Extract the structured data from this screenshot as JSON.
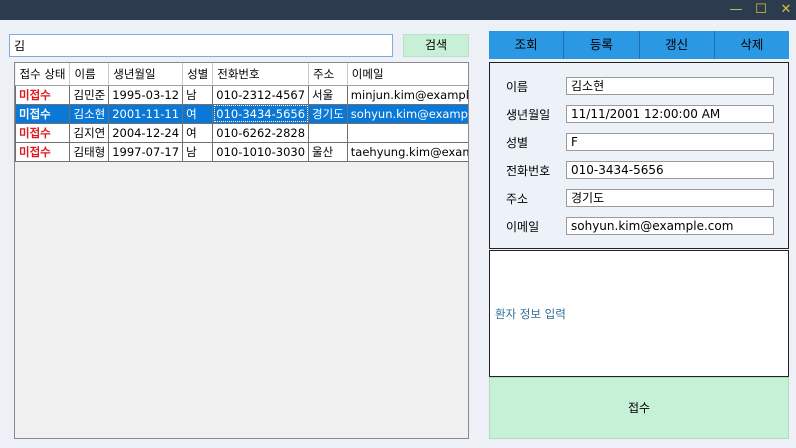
{
  "window": {
    "minimize_glyph": "—",
    "maximize_glyph": "☐",
    "close_glyph": "✕"
  },
  "search": {
    "value": "김",
    "button_label": "검색"
  },
  "patient_table": {
    "columns": [
      "접수 상태",
      "이름",
      "생년월일",
      "성별",
      "전화번호",
      "주소",
      "이메일"
    ],
    "rows": [
      {
        "status": "미접수",
        "name": "김민준",
        "birth": "1995-03-12",
        "gender": "남",
        "phone": "010-2312-4567",
        "address": "서울",
        "email": "minjun.kim@example.com"
      },
      {
        "status": "미접수",
        "name": "김소현",
        "birth": "2001-11-11",
        "gender": "여",
        "phone": "010-3434-5656",
        "address": "경기도",
        "email": "sohyun.kim@example.com"
      },
      {
        "status": "미접수",
        "name": "김지연",
        "birth": "2004-12-24",
        "gender": "여",
        "phone": "010-6262-2828",
        "address": "",
        "email": ""
      },
      {
        "status": "미접수",
        "name": "김태형",
        "birth": "1997-07-17",
        "gender": "남",
        "phone": "010-1010-3030",
        "address": "울산",
        "email": "taehyung.kim@example.com"
      }
    ],
    "selected_row": 1
  },
  "tabs": [
    "조회",
    "등록",
    "갱신",
    "삭제"
  ],
  "details": {
    "name_label": "이름",
    "name_value": "김소현",
    "birth_label": "생년월일",
    "birth_value": "11/11/2001 12:00:00 AM",
    "gender_label": "성별",
    "gender_value": "F",
    "phone_label": "전화번호",
    "phone_value": "010-3434-5656",
    "address_label": "주소",
    "address_value": "경기도",
    "email_label": "이메일",
    "email_value": "sohyun.kim@example.com"
  },
  "input_panel": {
    "hint": "환자 정보 입력"
  },
  "register": {
    "button_label": "접수"
  },
  "colors": {
    "titlebar": "#2d3b4e",
    "accent_tab": "#2b98e4",
    "selection": "#0a78d7",
    "status_red": "#e0181b",
    "green_button": "#c6f1d6"
  }
}
